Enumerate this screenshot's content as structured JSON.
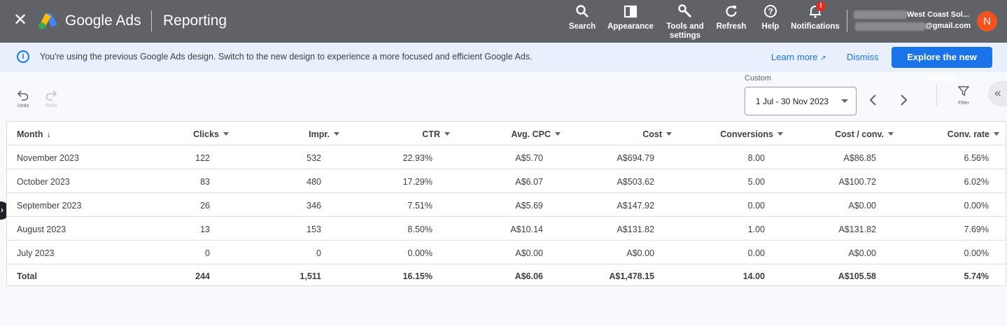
{
  "header": {
    "close_icon": "close-icon",
    "brand": "Google Ads",
    "page_title": "Reporting",
    "tools": [
      {
        "label": "Search",
        "icon": "search-icon"
      },
      {
        "label": "Appearance",
        "icon": "appearance-icon"
      },
      {
        "label": "Tools and settings",
        "icon": "wrench-icon"
      },
      {
        "label": "Refresh",
        "icon": "refresh-icon"
      },
      {
        "label": "Help",
        "icon": "help-icon"
      },
      {
        "label": "Notifications",
        "icon": "bell-icon"
      }
    ],
    "notification_badge": "!",
    "account_name": "West Coast Sol...",
    "account_email": "@gmail.com",
    "avatar_initial": "N"
  },
  "banner": {
    "message": "You're using the previous Google Ads design. Switch to the new design to experience a more focused and efficient Google Ads.",
    "learn_more": "Learn more",
    "dismiss": "Dismiss",
    "explore": "Explore the new design"
  },
  "toolbar": {
    "undo": "Undo",
    "redo": "Redo",
    "date_label": "Custom",
    "date_range": "1 Jul - 30 Nov 2023",
    "filter": "Filter"
  },
  "table": {
    "columns": [
      "Month",
      "Clicks",
      "Impr.",
      "CTR",
      "Avg. CPC",
      "Cost",
      "Conversions",
      "Cost / conv.",
      "Conv. rate"
    ],
    "rows": [
      [
        "November 2023",
        "122",
        "532",
        "22.93%",
        "A$5.70",
        "A$694.79",
        "8.00",
        "A$86.85",
        "6.56%"
      ],
      [
        "October 2023",
        "83",
        "480",
        "17.29%",
        "A$6.07",
        "A$503.62",
        "5.00",
        "A$100.72",
        "6.02%"
      ],
      [
        "September 2023",
        "26",
        "346",
        "7.51%",
        "A$5.69",
        "A$147.92",
        "0.00",
        "A$0.00",
        "0.00%"
      ],
      [
        "August 2023",
        "13",
        "153",
        "8.50%",
        "A$10.14",
        "A$131.82",
        "1.00",
        "A$131.82",
        "7.69%"
      ],
      [
        "July 2023",
        "0",
        "0",
        "0.00%",
        "A$0.00",
        "A$0.00",
        "0.00",
        "A$0.00",
        "0.00%"
      ]
    ],
    "total": [
      "Total",
      "244",
      "1,511",
      "16.15%",
      "A$6.06",
      "A$1,478.15",
      "14.00",
      "A$105.58",
      "5.74%"
    ]
  }
}
